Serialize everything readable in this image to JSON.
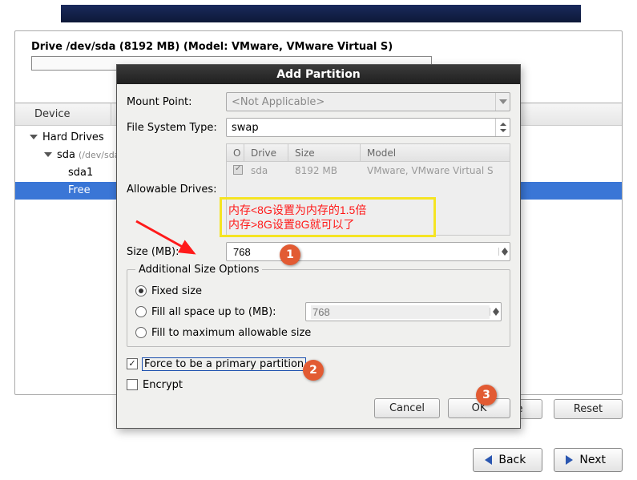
{
  "drive": {
    "info": "Drive /dev/sda (8192 MB) (Model: VMware, VMware Virtual S)"
  },
  "tree": {
    "header_device": "Device",
    "root": "Hard Drives",
    "disk": "sda",
    "disk_path": "(/dev/sda)",
    "part1": "sda1",
    "free": "Free"
  },
  "buttons": {
    "delete": "ete",
    "reset": "Reset",
    "back": "Back",
    "next": "Next"
  },
  "dialog": {
    "title": "Add Partition",
    "mount_point_label": "Mount Point:",
    "mount_point_value": "<Not Applicable>",
    "fs_type_label": "File System Type:",
    "fs_type_value": "swap",
    "allowable_label": "Allowable Drives:",
    "drives_table": {
      "headers": {
        "chk": "O",
        "drive": "Drive",
        "size": "Size",
        "model": "Model"
      },
      "row": {
        "drive": "sda",
        "size": "8192 MB",
        "model": "VMware, VMware Virtual S"
      }
    },
    "size_label": "Size (MB):",
    "size_value": "768",
    "aso_title": "Additional Size Options",
    "radio_fixed": "Fixed size",
    "radio_fillup": "Fill all space up to (MB):",
    "fillup_value": "768",
    "radio_fillmax": "Fill to maximum allowable size",
    "chk_primary": "Force to be a primary partition",
    "chk_encrypt": "Encrypt",
    "cancel": "Cancel",
    "ok": "OK"
  },
  "annotations": {
    "box_line1": "内存<8G设置为内存的1.5倍",
    "box_line2": "内存>8G设置8G就可以了",
    "m1": "1",
    "m2": "2",
    "m3": "3"
  }
}
